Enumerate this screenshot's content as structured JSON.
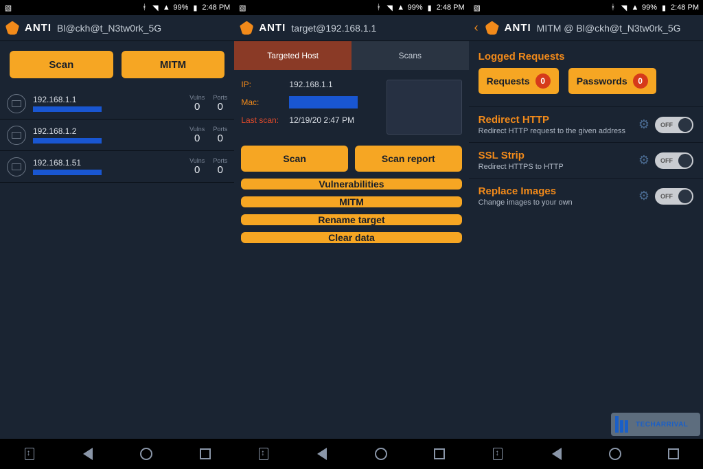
{
  "status_bar": {
    "battery": "99%",
    "time": "2:48 PM"
  },
  "app_name": "ANTI",
  "screen1": {
    "subtitle": "Bl@ckh@t_N3tw0rk_5G",
    "scan_label": "Scan",
    "mitm_label": "MITM",
    "vulns_label": "Vulns",
    "ports_label": "Ports",
    "hosts": [
      {
        "ip": "192.168.1.1",
        "vulns": "0",
        "ports": "0"
      },
      {
        "ip": "192.168.1.2",
        "vulns": "0",
        "ports": "0"
      },
      {
        "ip": "192.168.1.51",
        "vulns": "0",
        "ports": "0"
      }
    ]
  },
  "screen2": {
    "subtitle": "target@192.168.1.1",
    "tab_host": "Targeted Host",
    "tab_scans": "Scans",
    "ip_label": "IP:",
    "ip_value": "192.168.1.1",
    "mac_label": "Mac:",
    "lastscan_label": "Last scan:",
    "lastscan_value": "12/19/20 2:47 PM",
    "btn_scan": "Scan",
    "btn_report": "Scan report",
    "btn_vuln": "Vulnerabilities",
    "btn_mitm": "MITM",
    "btn_rename": "Rename target",
    "btn_clear": "Clear data"
  },
  "screen3": {
    "subtitle": "MITM @ Bl@ckh@t_N3tw0rk_5G",
    "logged_title": "Logged Requests",
    "requests_label": "Requests",
    "requests_count": "0",
    "passwords_label": "Passwords",
    "passwords_count": "0",
    "toggle_off": "OFF",
    "settings": [
      {
        "title": "Redirect HTTP",
        "desc": "Redirect HTTP request to the given address"
      },
      {
        "title": "SSL Strip",
        "desc": "Redirect HTTPS to HTTP"
      },
      {
        "title": "Replace Images",
        "desc": "Change images to your own"
      }
    ]
  },
  "watermark": "TECHARRIVAL"
}
